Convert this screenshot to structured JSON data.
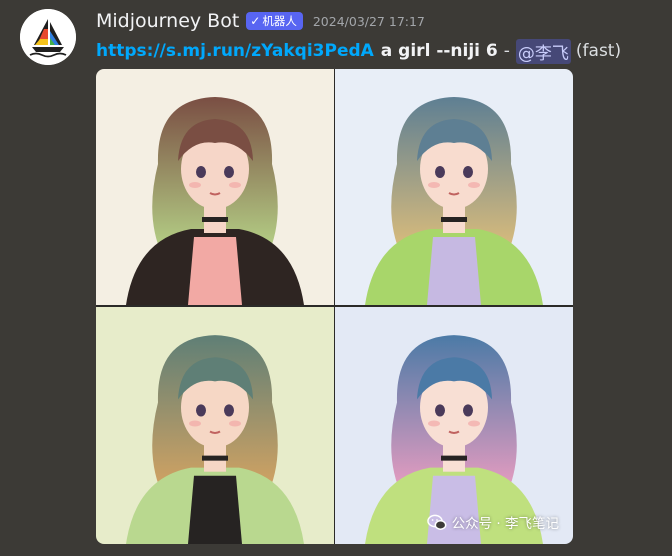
{
  "message": {
    "username": "Midjourney Bot",
    "bot_tag": {
      "check": "✓",
      "label": "机器人"
    },
    "timestamp": "2024/03/27 17:17",
    "link_text": "https://s.mj.run/zYakqi3PedA",
    "prompt_text": "a girl --niji 6",
    "separator": "-",
    "mention": "@李飞",
    "speed": "(fast)"
  },
  "image_grid": {
    "cells": [
      {
        "palette": {
          "bg": "#f4efe3",
          "hair": "#7a4e43",
          "hair_tip": "#b8d88a",
          "jacket": "#2e2522",
          "shirt": "#f2a9a4",
          "skin": "#f6d6c8"
        }
      },
      {
        "palette": {
          "bg": "#e8eef7",
          "hair": "#5e7f93",
          "hair_tip": "#e2c07a",
          "jacket": "#a8d66a",
          "shirt": "#c6b9e2",
          "skin": "#f8dccf"
        }
      },
      {
        "palette": {
          "bg": "#e7ecca",
          "hair": "#5f7f76",
          "hair_tip": "#d9a561",
          "jacket": "#b9d88f",
          "shirt": "#262322",
          "skin": "#f6d7c5"
        }
      },
      {
        "palette": {
          "bg": "#e3e9f5",
          "hair": "#4b7aa6",
          "hair_tip": "#ef9ec2",
          "jacket": "#bfe07e",
          "shirt": "#c9bde6",
          "skin": "#f8dfd4"
        }
      }
    ]
  },
  "watermark": {
    "text": "公众号 · 李飞笔记"
  }
}
